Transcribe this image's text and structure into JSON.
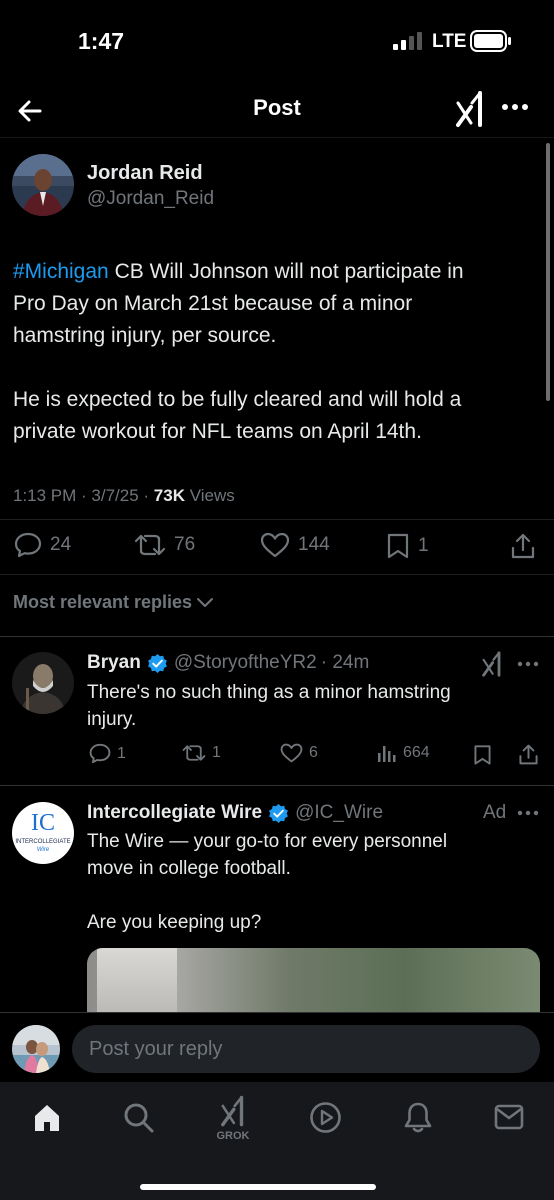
{
  "status_bar": {
    "time": "1:47",
    "network": "LTE"
  },
  "header": {
    "title": "Post"
  },
  "post": {
    "author_name": "Jordan Reid",
    "author_handle": "@Jordan_Reid",
    "hashtag": "#Michigan",
    "text_line1_rest": " CB Will Johnson will not participate in",
    "text_line2": "Pro Day on March 21st because of a minor",
    "text_line3": "hamstring injury, per source.",
    "text_line4": "He is expected to be fully cleared and will hold a",
    "text_line5": "private workout for NFL teams on April 14th.",
    "timestamp": "1:13 PM · 3/7/25 · ",
    "views_count": "73K",
    "views_label": " Views",
    "stats": {
      "replies": "24",
      "reposts": "76",
      "likes": "144",
      "bookmarks": "1"
    }
  },
  "replies_filter": {
    "label": "Most relevant replies"
  },
  "reply": {
    "name": "Bryan",
    "handle": "@StoryoftheYR2",
    "time": "· 24m",
    "text_line1": "There's no such thing as a minor hamstring",
    "text_line2": "injury.",
    "stats": {
      "replies": "1",
      "reposts": "1",
      "likes": "6",
      "views": "664"
    }
  },
  "ad": {
    "name": "Intercollegiate Wire",
    "handle": "@IC_Wire",
    "ad_label": "Ad",
    "logo_initials": "IC",
    "logo_line1": "INTERCOLLEGIATE",
    "logo_line2": "Wire",
    "text_line1": "The Wire — your go-to for every personnel",
    "text_line2": "move in college football.",
    "text_line3": "Are you keeping up?"
  },
  "composer": {
    "placeholder": "Post your reply"
  },
  "tab_bar": {
    "grok_label": "GROK"
  },
  "colors": {
    "accent": "#1d9bf0",
    "background": "#000000",
    "muted": "#71767b"
  }
}
